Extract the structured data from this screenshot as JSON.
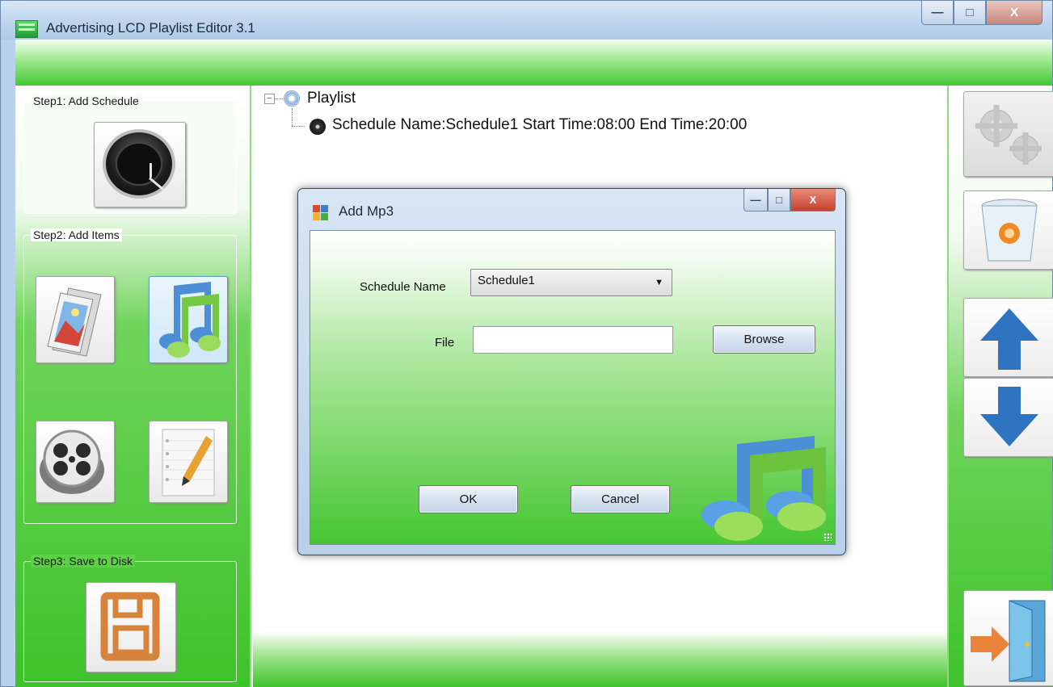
{
  "window": {
    "title": "Advertising LCD Playlist Editor 3.1",
    "controls": {
      "minimize": "—",
      "maximize": "□",
      "close": "X"
    }
  },
  "left_panel": {
    "step1": {
      "label": "Step1: Add Schedule",
      "icon": "clock-icon"
    },
    "step2": {
      "label": "Step2: Add Items",
      "items": [
        {
          "icon": "image-icon",
          "selected": false
        },
        {
          "icon": "music-icon",
          "selected": true
        },
        {
          "icon": "film-reel-icon",
          "selected": false
        },
        {
          "icon": "notepad-icon",
          "selected": false
        }
      ]
    },
    "step3": {
      "label": "Step3: Save to Disk",
      "icon": "save-disk-icon"
    }
  },
  "tree": {
    "root_toggle": "−",
    "root_label": "Playlist",
    "schedule_label": "Schedule Name:Schedule1  Start Time:08:00  End Time:20:00"
  },
  "right_panel": {
    "buttons": [
      "settings-icon",
      "recycle-bin-icon",
      "arrow-up-icon",
      "arrow-down-icon",
      "exit-door-icon"
    ]
  },
  "dialog": {
    "title": "Add Mp3",
    "schedule_name_label": "Schedule Name",
    "schedule_name_value": "Schedule1",
    "file_label": "File",
    "file_value": "",
    "browse_label": "Browse",
    "ok_label": "OK",
    "cancel_label": "Cancel",
    "icon": "music-notes-icon"
  },
  "colors": {
    "accent_green": "#3ec22b",
    "window_blue": "#b9d1ea",
    "close_red": "#c4412d"
  }
}
